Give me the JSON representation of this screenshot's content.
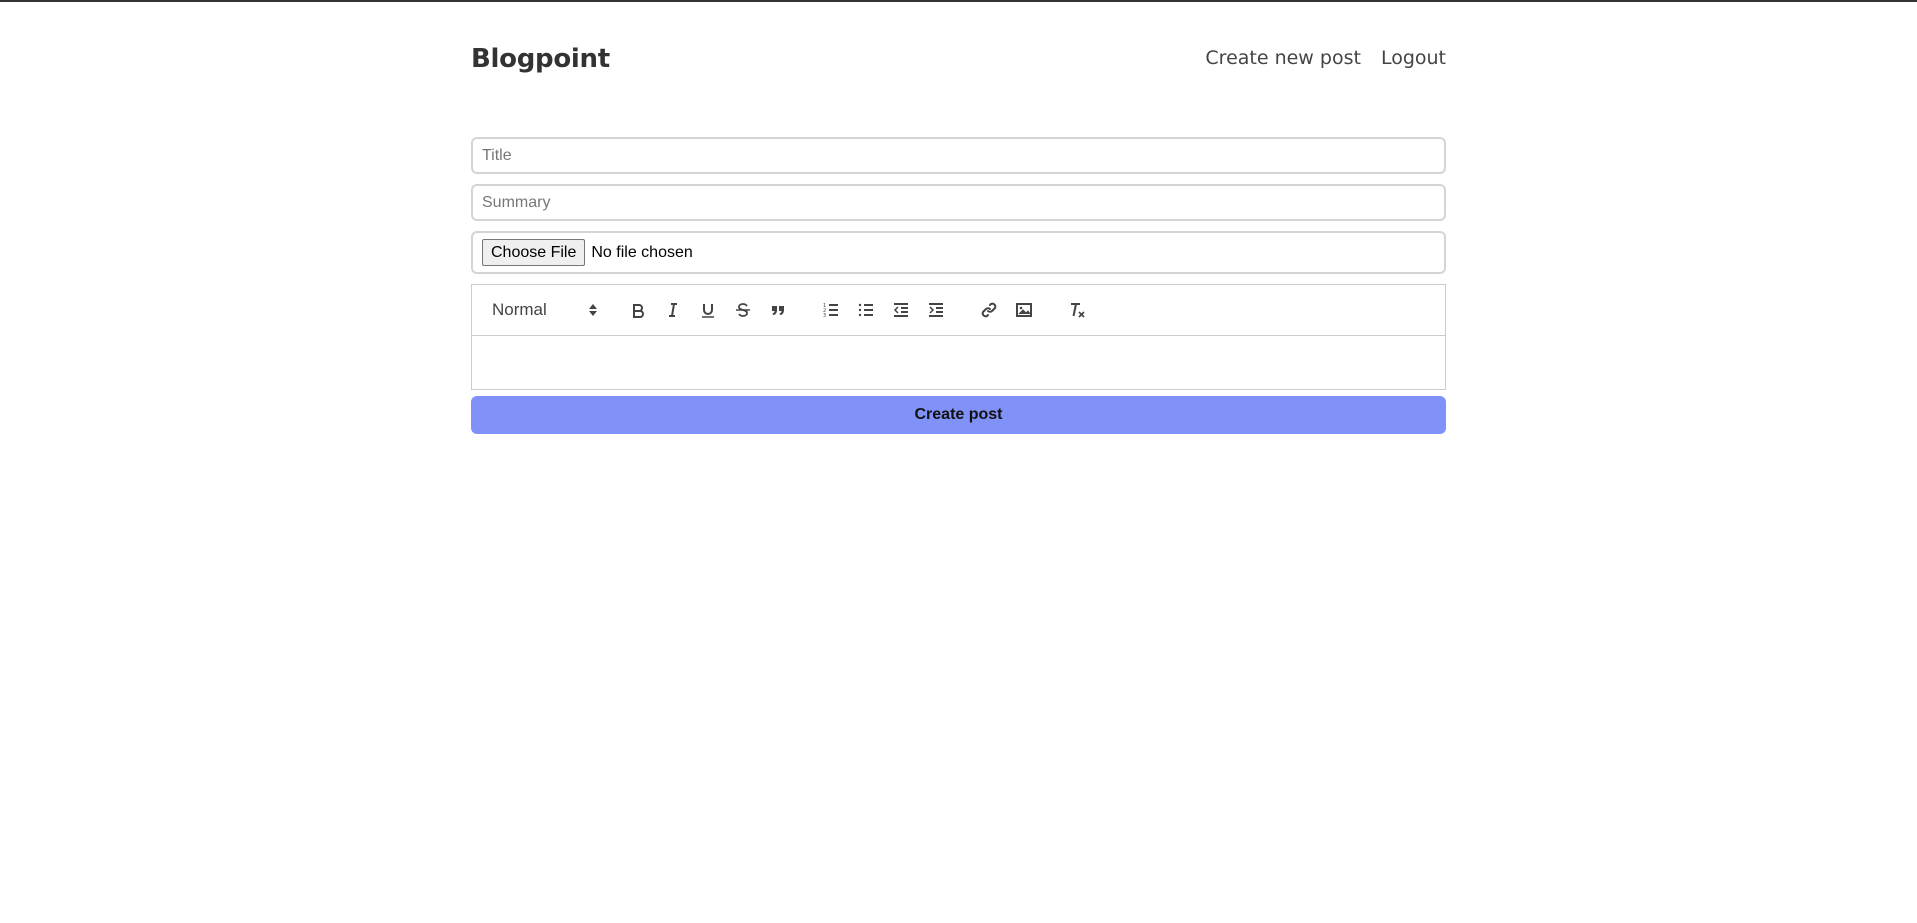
{
  "header": {
    "brand": "Blogpoint",
    "nav": {
      "create_new_post": "Create new post",
      "logout": "Logout"
    }
  },
  "form": {
    "title_placeholder": "Title",
    "summary_placeholder": "Summary",
    "file": {
      "button_label": "Choose File",
      "status": "No file chosen"
    },
    "editor": {
      "format_selected": "Normal",
      "toolbar_icons": [
        "bold-icon",
        "italic-icon",
        "underline-icon",
        "strikethrough-icon",
        "blockquote-icon",
        "ordered-list-icon",
        "bullet-list-icon",
        "outdent-icon",
        "indent-icon",
        "link-icon",
        "image-icon",
        "clear-format-icon"
      ]
    },
    "submit_label": "Create post"
  },
  "colors": {
    "submit_button": "#8092f7",
    "border": "#d4d4d4",
    "text": "#333333"
  }
}
